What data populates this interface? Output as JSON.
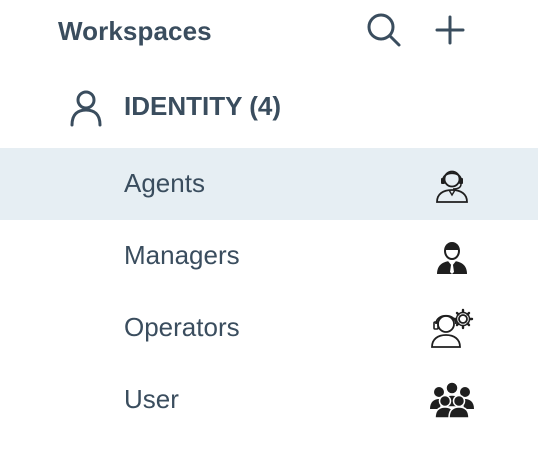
{
  "header": {
    "title": "Workspaces",
    "search_icon": "search-icon",
    "add_icon": "plus-icon"
  },
  "group": {
    "label": "IDENTITY (4)",
    "icon": "user-outline-icon"
  },
  "items": [
    {
      "label": "Agents",
      "icon": "headset-agent-icon",
      "selected": true
    },
    {
      "label": "Managers",
      "icon": "manager-tie-icon",
      "selected": false
    },
    {
      "label": "Operators",
      "icon": "operator-gear-icon",
      "selected": false
    },
    {
      "label": "User",
      "icon": "user-group-icon",
      "selected": false
    }
  ],
  "colors": {
    "text": "#3a4d5e",
    "selected_background": "#e6eef3",
    "icon": "#1f1f1f"
  }
}
